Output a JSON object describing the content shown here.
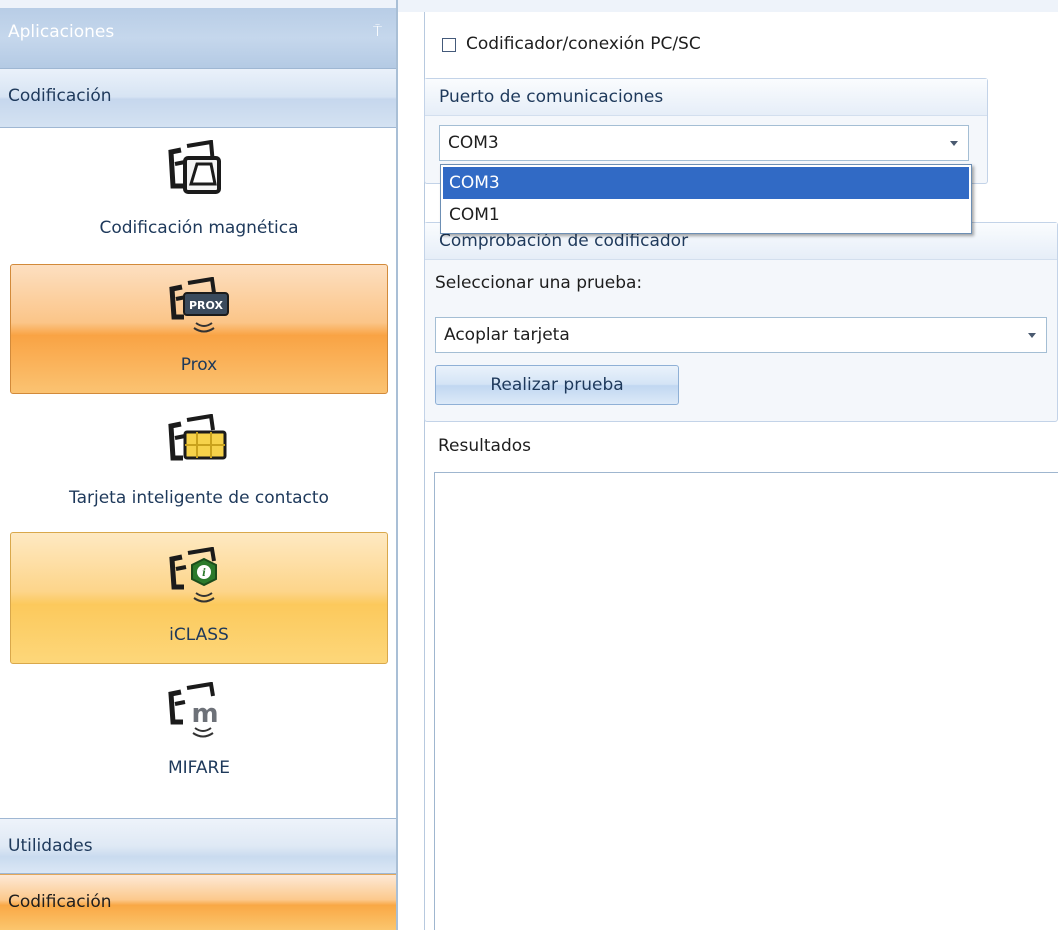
{
  "sidebar": {
    "header_title": "Aplicaciones",
    "pin_glyph": "⍑",
    "group_label": "Codificación",
    "items": [
      {
        "label": "Codificación magnética",
        "icon": "magnetic-card-icon"
      },
      {
        "label": "Prox",
        "icon": "prox-card-icon"
      },
      {
        "label": "Tarjeta inteligente de contacto",
        "icon": "smart-chip-card-icon"
      },
      {
        "label": "iCLASS",
        "icon": "iclass-card-icon"
      },
      {
        "label": "MIFARE",
        "icon": "mifare-card-icon"
      }
    ],
    "bottom_groups": [
      {
        "label": "Utilidades"
      },
      {
        "label": "Codificación"
      }
    ]
  },
  "main": {
    "checkbox_label": "Codificador/conexión PC/SC",
    "checkbox_checked": false,
    "puerto": {
      "title": "Puerto de comunicaciones",
      "selected_value": "COM3",
      "options": [
        "COM3",
        "COM1"
      ]
    },
    "comprobacion": {
      "title": "Comprobación de codificador",
      "select_label": "Seleccionar una prueba:",
      "selected_test": "Acoplar tarjeta",
      "button_label": "Realizar prueba"
    },
    "results_label": "Resultados"
  },
  "colors": {
    "selected_item": "#f9a344",
    "hover_item": "#fcc95c",
    "dropdown_highlight": "#316ac5",
    "header_blue": "#b8cde6"
  }
}
